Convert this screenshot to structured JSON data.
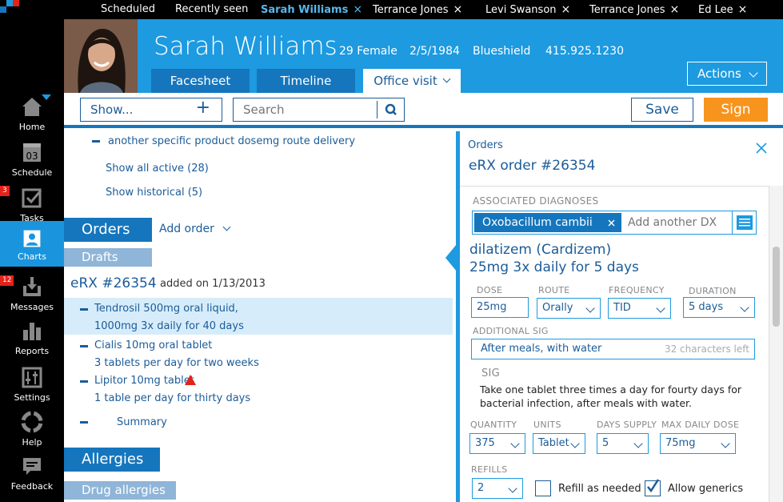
{
  "top_tabs": [
    {
      "label": "Scheduled",
      "closable": false
    },
    {
      "label": "Recently seen",
      "closable": false
    },
    {
      "label": "Sarah Williams",
      "closable": true,
      "active": true
    },
    {
      "label": "Terrance Jones",
      "closable": true
    },
    {
      "label": "Levi Swanson",
      "closable": true
    },
    {
      "label": "Terrance Jones",
      "closable": true
    },
    {
      "label": "Ed Lee",
      "closable": true
    }
  ],
  "close_glyph": "×",
  "sidebar": {
    "items": [
      {
        "label": "Home",
        "icon": "home-icon"
      },
      {
        "label": "Schedule",
        "icon": "calendar-icon",
        "day": "03"
      },
      {
        "label": "Tasks",
        "icon": "checkbox-icon",
        "badge": "3"
      },
      {
        "label": "Charts",
        "icon": "person-icon",
        "active": true
      },
      {
        "label": "Messages",
        "icon": "inbox-icon",
        "badge": "12"
      },
      {
        "label": "Reports",
        "icon": "bar-chart-icon"
      },
      {
        "label": "Settings",
        "icon": "sliders-icon"
      },
      {
        "label": "Help",
        "icon": "lifebuoy-icon"
      },
      {
        "label": "Feedback",
        "icon": "speech-bubble-icon"
      }
    ]
  },
  "patient": {
    "name": "Sarah Williams",
    "age_sex": "29 Female",
    "dob": "2/5/1984",
    "insurance": "Blueshield",
    "phone": "415.925.1230"
  },
  "header_tabs": [
    {
      "label": "Facesheet"
    },
    {
      "label": "Timeline"
    },
    {
      "label": "Office visit",
      "active": true
    }
  ],
  "actions_label": "Actions",
  "toolbar": {
    "show_label": "Show...",
    "show_plus": "+",
    "search_placeholder": "Search",
    "save_label": "Save",
    "sign_label": "Sign"
  },
  "left": {
    "med_line": "another specific product dosemg route delivery",
    "show_active": "Show all active (28)",
    "show_historical": "Show historical (5)",
    "orders_title": "Orders",
    "add_order": "Add order",
    "drafts": "Drafts",
    "erx_title": "eRX #26354",
    "erx_added": "added on 1/13/2013",
    "items": [
      {
        "line1": "Tendrosil 500mg oral liquid,",
        "line2": "1000mg 3x daily for 40 days",
        "selected": true
      },
      {
        "line1": "Cialis 10mg oral tablet",
        "line2": "3 tablets per day for two weeks"
      },
      {
        "line1": "Lipitor 10mg tablet",
        "line2": "1 table per day for thirty days",
        "warning": true
      },
      {
        "line1": "Summary"
      }
    ],
    "allergies_title": "Allergies",
    "drug_allergies": "Drug allergies"
  },
  "right": {
    "section": "Orders",
    "title": "eRX order #26354",
    "assoc_label": "ASSOCIATED DIAGNOSES",
    "dx_chip": "Oxobacillum cambii",
    "dx_placeholder": "Add another DX",
    "drug_name": "dilatizem (Cardizem)",
    "drug_dose": "25mg 3x daily for 5 days",
    "dose_label": "DOSE",
    "dose": "25mg",
    "route_label": "ROUTE",
    "route": "Orally",
    "freq_label": "FREQUENCY",
    "freq": "TID",
    "duration_label": "DURATION",
    "duration": "5 days",
    "addsig_label": "ADDITIONAL SIG",
    "addsig": "After meals, with water",
    "addsig_hint": "32 characters left",
    "sig_label": "SIG",
    "sig_text": "Take one tablet three times a day for fourty days for bacterial infection, after meals with water.",
    "qty_label": "QUANTITY",
    "qty": "375",
    "units_label": "UNITS",
    "units": "Tablet",
    "days_label": "DAYS SUPPLY",
    "days": "5",
    "maxdose_label": "MAX DAILY DOSE",
    "maxdose": "75mg",
    "refills_label": "REFILLS",
    "refills": "2",
    "refill_needed": "Refill as needed",
    "refill_checked": false,
    "generics": "Allow generics",
    "generics_checked": true
  },
  "colors": {
    "accent": "#1d9ae0",
    "dark": "#1576bd",
    "text": "#1b5c99",
    "sign": "#f7941d",
    "badge": "#e3221a"
  }
}
